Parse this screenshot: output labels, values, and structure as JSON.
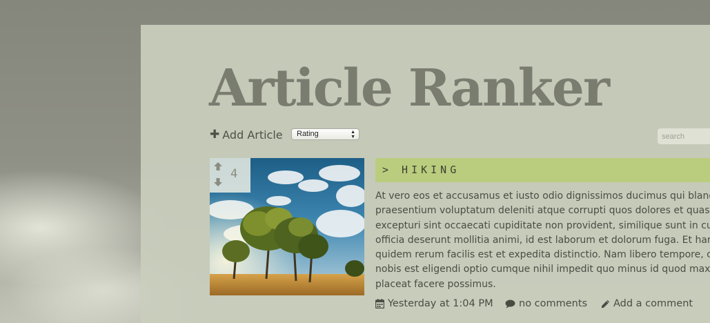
{
  "site": {
    "title": "Article Ranker"
  },
  "toolbar": {
    "add_label": "Add Article",
    "sort_selected": "Rating",
    "search_placeholder": "search"
  },
  "article": {
    "votes": "4",
    "category": "> HIKING",
    "body_lines": [
      "At vero eos et accusamus et iusto odio dignissimos ducimus qui blandi",
      "praesentium voluptatum deleniti atque corrupti quos dolores et quas",
      "excepturi sint occaecati cupiditate non provident, similique sunt in culpa",
      "officia deserunt mollitia animi, id est laborum et dolorum fuga. Et harum",
      "quidem rerum facilis est et expedita distinctio. Nam libero tempore, cum",
      "nobis est eligendi optio cumque nihil impedit quo minus id quod maxime",
      "placeat facere possimus."
    ],
    "date": "Yesterday at 1:04 PM",
    "comments": "no comments",
    "add_comment": "Add a comment"
  },
  "colors": {
    "category_bar": "#bacd7e",
    "panel": "#c9cdbc",
    "title": "#7a7c70"
  },
  "icons": {
    "add": "plus-icon",
    "select": "select-arrows-icon",
    "vote_up": "arrow-up-icon",
    "vote_down": "arrow-down-icon",
    "date": "calendar-icon",
    "comments": "comment-bubble-icon",
    "add_comment": "pencil-icon"
  }
}
